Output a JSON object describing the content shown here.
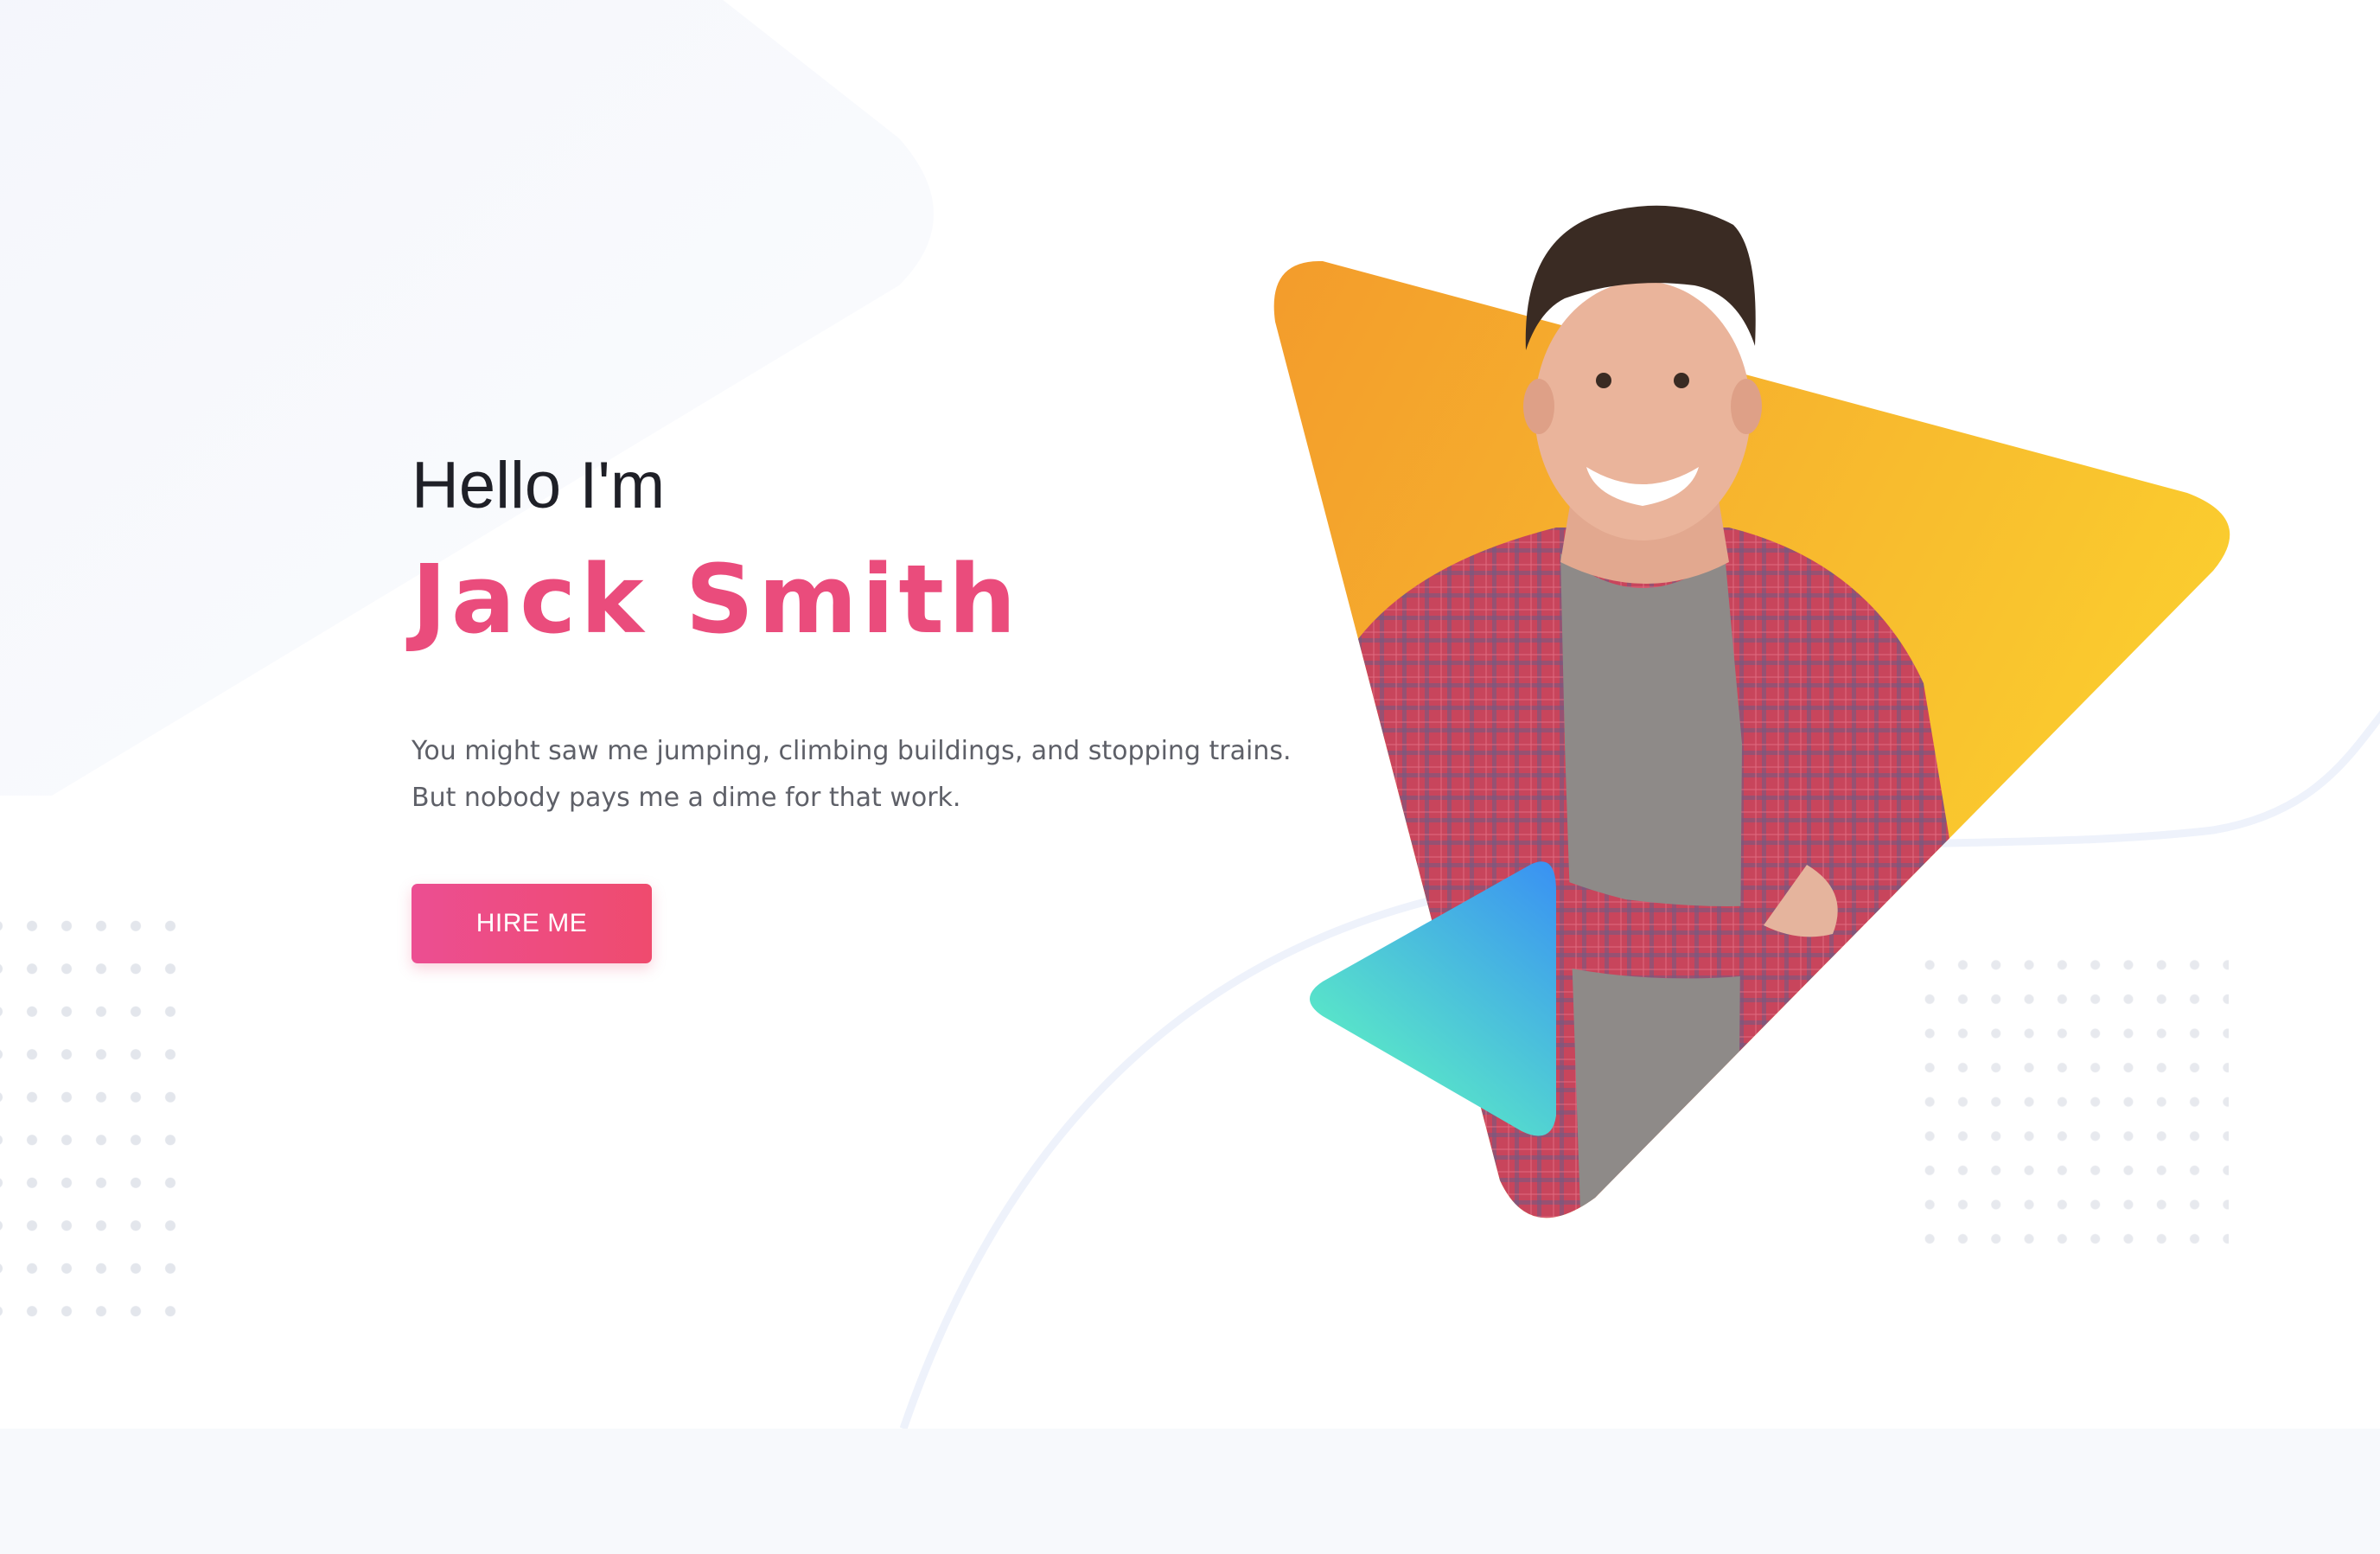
{
  "hero": {
    "greeting": "Hello I'm",
    "name": "Jack Smith",
    "description_lines": [
      "You might saw me jumping, climbing buildings, and stopping trains.",
      "But nobody pays me a dime for that work."
    ],
    "cta_label": "HIRE ME"
  },
  "colors": {
    "accent_pink": "#ea4c7c",
    "button_gradient_start": "#ec4e92",
    "button_gradient_end": "#ef4b6e",
    "triangle_orange": "#f39c2c",
    "triangle_yellow": "#fbd12f",
    "play_blue": "#3a93f2",
    "play_green": "#5ef3c2",
    "text_dark": "#1f2027",
    "text_muted": "#5e6068",
    "background": "#ffffff",
    "bottom_band": "#f7f9fc"
  },
  "icons": {
    "play": "play-triangle-icon"
  }
}
